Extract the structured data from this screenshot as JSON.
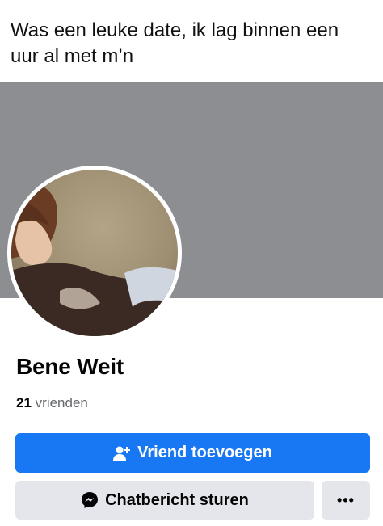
{
  "caption": "Was een leuke date, ik lag binnen een uur al met m’n",
  "profile": {
    "name": "Bene Weit",
    "friends_count": "21",
    "friends_label": "vrienden"
  },
  "actions": {
    "add_friend_label": "Vriend toevoegen",
    "add_friend_icon": "person-add-icon",
    "message_label": "Chatbericht sturen",
    "message_icon": "messenger-icon",
    "more_label": "•••"
  },
  "colors": {
    "cover": "#8c8e91",
    "primary": "#1877f2",
    "secondary": "#e4e6eb"
  }
}
